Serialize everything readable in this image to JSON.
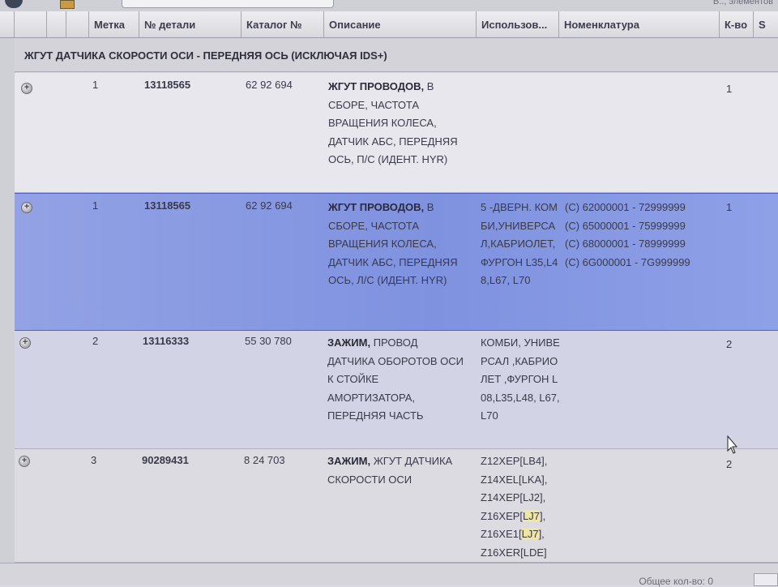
{
  "toolbar": {
    "count_text": "В.., элементов"
  },
  "columns": {
    "mark": "Метка",
    "part_no": "№ детали",
    "catalog_no": "Каталог №",
    "description": "Описание",
    "usage": "Использов...",
    "nomenclature": "Номенклатура",
    "qty": "К-во",
    "s": "S"
  },
  "group_title": "ЖГУТ ДАТЧИКА СКОРОСТИ ОСИ - ПЕРЕДНЯЯ ОСЬ (ИСКЛЮЧАЯ IDS+)",
  "rows": [
    {
      "mark": "1",
      "part_no": "13118565",
      "catalog_no": "62 92 694",
      "desc_bold": "ЖГУТ ПРОВОДОВ,",
      "desc_rest": " В СБОРЕ, ЧАСТОТА ВРАЩЕНИЯ КОЛЕСА, ДАТЧИК АБС, ПЕРЕДНЯЯ ОСЬ, П/С (ИДЕНТ. HYR)",
      "usage": "",
      "nomenclature": [],
      "qty": "1"
    },
    {
      "mark": "1",
      "part_no": "13118565",
      "catalog_no": "62 92 694",
      "desc_bold": "ЖГУТ ПРОВОДОВ,",
      "desc_rest": " В СБОРЕ, ЧАСТОТА ВРАЩЕНИЯ КОЛЕСА, ДАТЧИК АБС, ПЕРЕДНЯЯ ОСЬ, Л/С (ИДЕНТ. HYR)",
      "usage": "5 -ДВЕРН. КОМБИ,УНИВЕРСАЛ,КАБРИОЛЕТ,ФУРГОН L35,L48,L67, L70",
      "nomenclature": [
        "(C) 62000001 - 72999999",
        "(C) 65000001 - 75999999",
        "(C) 68000001 - 78999999",
        "(C) 6G000001 - 7G999999"
      ],
      "qty": "1"
    },
    {
      "mark": "2",
      "part_no": "13116333",
      "catalog_no": "55 30 780",
      "desc_bold": "ЗАЖИМ,",
      "desc_rest": " ПРОВОД ДАТЧИКА ОБОРОТОВ ОСИ К СТОЙКЕ АМОРТИЗАТОРА, ПЕРЕДНЯЯ ЧАСТЬ",
      "usage": "КОМБИ, УНИВЕРСАЛ ,КАБРИОЛЕТ ,ФУРГОН L08,L35,L48, L67,L70",
      "nomenclature": [],
      "qty": "2"
    },
    {
      "mark": "3",
      "part_no": "90289431",
      "catalog_no": "8 24 703",
      "desc_bold": "ЗАЖИМ,",
      "desc_rest": " ЖГУТ ДАТЧИКА СКОРОСТИ ОСИ",
      "usage_lines": [
        "Z12XEP[LB4],",
        "Z14XEL[LKA],",
        "Z14XEP[LJ2],",
        "Z16XEP[",
        "LJ7",
        "],",
        "Z16XE1[",
        "LJ7",
        "],",
        "Z16XER[LDE]"
      ],
      "usage_l1": "Z12XEP[LB4],",
      "usage_l2": "Z14XEL[LKA],",
      "usage_l3": "Z14XEP[LJ2],",
      "usage_l4a": "Z16XEP[",
      "usage_l4b": "LJ7",
      "usage_l4c": "],",
      "usage_l5a": "Z16XE1[",
      "usage_l5b": "LJ7",
      "usage_l5c": "],",
      "usage_l6": "Z16XER[LDE]",
      "nomenclature": [],
      "qty": "2"
    }
  ],
  "footer": {
    "total_text": "Общее кол-во: 0"
  },
  "colors": {
    "selected_row": "#8193e0",
    "highlight": "#efe6a6"
  }
}
